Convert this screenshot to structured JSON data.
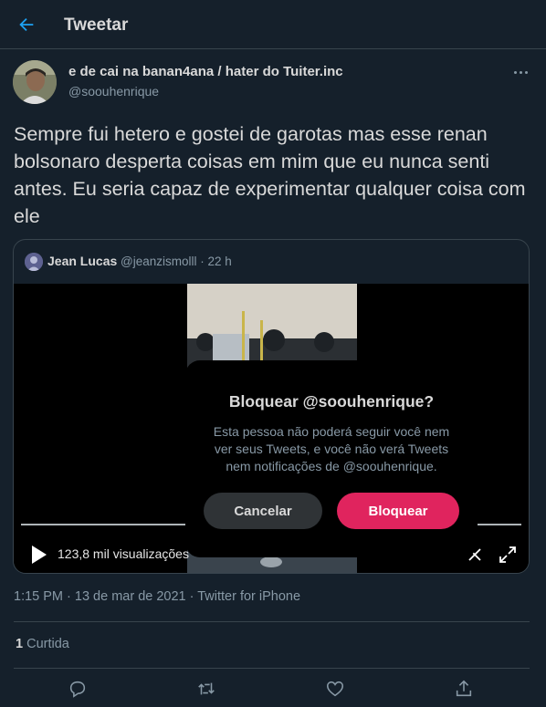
{
  "header": {
    "title": "Tweetar",
    "back_icon": "back-arrow-icon"
  },
  "tweet": {
    "author_name": "e de cai na banan4ana / hater do Tuiter.inc",
    "author_handle": "@soouhenrique",
    "text": "Sempre fui hetero e gostei de garotas mas esse renan bolsonaro desperta coisas em mim que eu nunca senti antes. Eu seria capaz de experimentar qualquer coisa com ele",
    "timestamp": "1:15 PM · 13 de mar de 2021 · Twitter for iPhone",
    "likes_count": "1",
    "likes_label": "Curtida"
  },
  "quoted": {
    "name": "Jean Lucas",
    "handle": "@jeanzismolll",
    "separator": "·",
    "time": "22 h",
    "views": "123,8 mil visualizações"
  },
  "modal": {
    "title": "Bloquear @soouhenrique?",
    "body": "Esta pessoa não poderá seguir você nem ver seus Tweets, e você não verá Tweets nem notificações de @soouhenrique.",
    "cancel_label": "Cancelar",
    "block_label": "Bloquear"
  },
  "colors": {
    "background": "#15202b",
    "accent": "#1da1f2",
    "danger": "#e0245e",
    "border": "#38444d",
    "secondary_text": "#8899a6"
  }
}
